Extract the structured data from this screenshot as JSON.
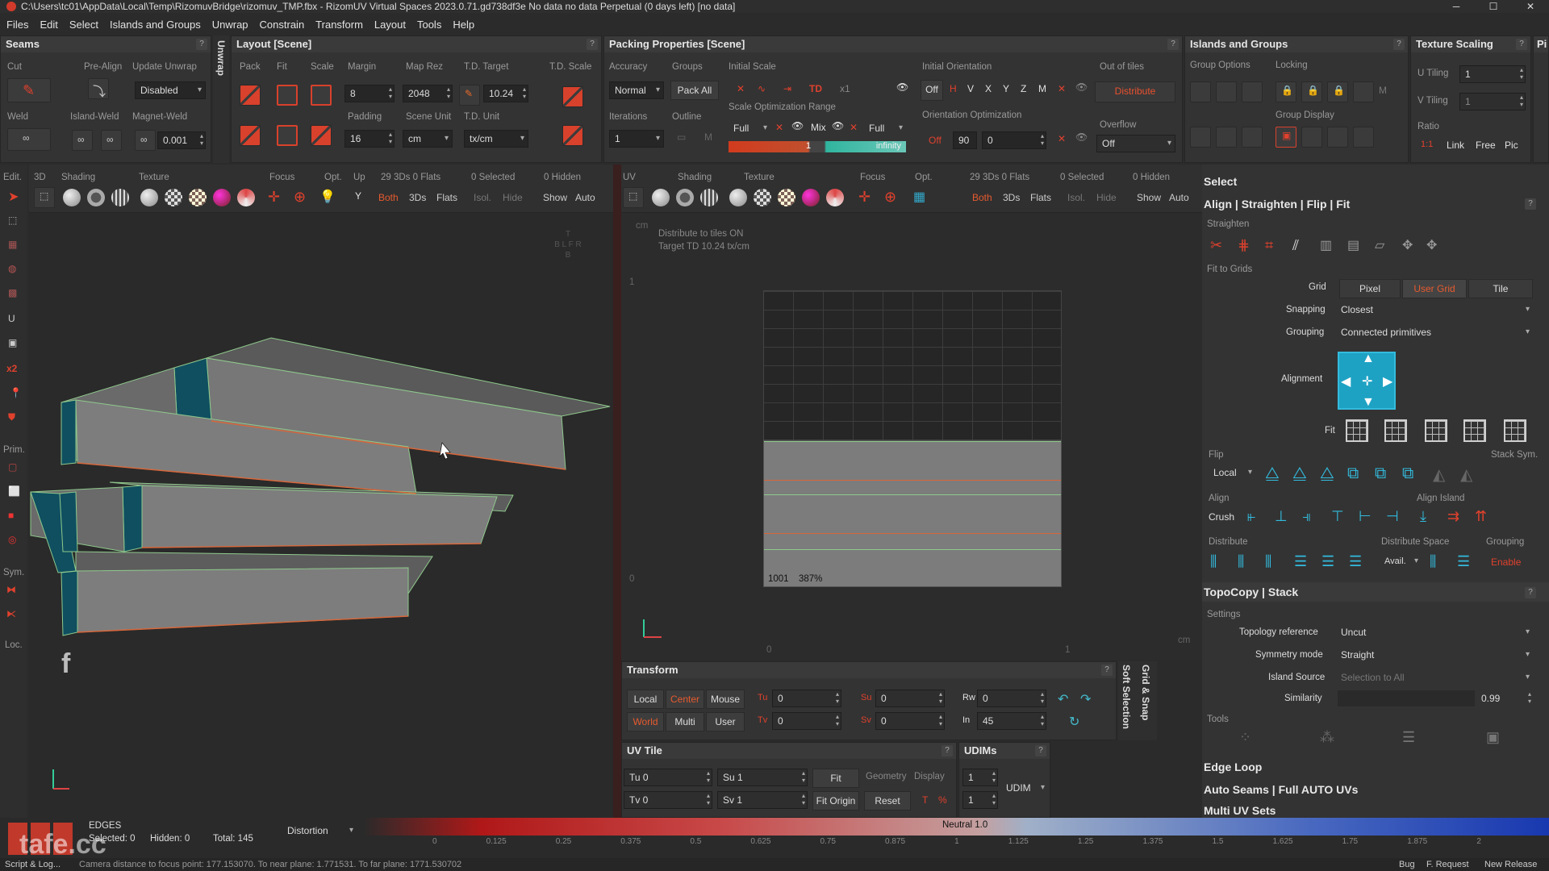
{
  "window": {
    "title": "C:\\Users\\tc01\\AppData\\Local\\Temp\\RizomuvBridge\\rizomuv_TMP.fbx - RizomUV  Virtual Spaces 2023.0.71.gd738df3e No data no data Perpetual  (0 days left) [no data]",
    "min": "─",
    "max": "☐",
    "close": "✕"
  },
  "menu": [
    "Files",
    "Edit",
    "Select",
    "Islands and Groups",
    "Unwrap",
    "Constrain",
    "Transform",
    "Layout",
    "Tools",
    "Help"
  ],
  "seams": {
    "title": "Seams",
    "help": "?",
    "cut": "Cut",
    "pre_align": "Pre-Align",
    "update_unwrap": "Update Unwrap",
    "update_value": "Disabled",
    "weld": "Weld",
    "island_weld": "Island-Weld",
    "magnet_weld": "Magnet-Weld",
    "magnet_value": "0.001",
    "unwrap_tab": "Unwrap"
  },
  "layout": {
    "title": "Layout [Scene]",
    "help": "?",
    "pack": "Pack",
    "fit": "Fit",
    "scale": "Scale",
    "margin": "Margin",
    "margin_value": "8",
    "map_rez": "Map Rez",
    "map_rez_value": "2048",
    "td_target": "T.D. Target",
    "td_target_value": "10.24",
    "td_scale": "T.D. Scale",
    "padding": "Padding",
    "padding_value": "16",
    "scene_unit": "Scene Unit",
    "scene_unit_value": "cm",
    "td_unit": "T.D. Unit",
    "td_unit_value": "tx/cm"
  },
  "packing": {
    "title": "Packing Properties [Scene]",
    "help": "?",
    "accuracy": "Accuracy",
    "accuracy_value": "Normal",
    "groups": "Groups",
    "pack_all": "Pack All",
    "initial_scale": "Initial Scale",
    "initial_scale_x1": "x1",
    "iterations": "Iterations",
    "iterations_value": "1",
    "outline": "Outline",
    "outline_m": "M",
    "scale_opt_range": "Scale Optimization Range",
    "full1": "Full",
    "mix": "Mix",
    "full2": "Full",
    "range_min": "1",
    "range_max": "infinity",
    "initial_orientation": "Initial Orientation",
    "orient_off": "Off",
    "orient_h": "H",
    "orient_v": "V",
    "orient_x": "X",
    "orient_y": "Y",
    "orient_z": "Z",
    "orient_m": "M",
    "orientation_optimization": "Orientation Optimization",
    "opt_off": "Off",
    "opt_step": "90",
    "opt_value": "0",
    "out_of_tiles": "Out of tiles",
    "distribute": "Distribute",
    "overflow": "Overflow",
    "overflow_value": "Off"
  },
  "islands": {
    "title": "Islands and Groups",
    "help": "?",
    "group_options": "Group Options",
    "locking": "Locking",
    "group_display": "Group Display",
    "m": "M"
  },
  "texture_scaling": {
    "title": "Texture Scaling",
    "help": "?",
    "u_tiling": "U Tiling",
    "u_value": "1",
    "v_tiling": "V Tiling",
    "v_value": "1",
    "ratio": "Ratio",
    "ratio_1_1": "1:1",
    "link": "Link",
    "free": "Free",
    "pic": "Pic",
    "cut_title": "Pi"
  },
  "vp3d": {
    "edit": "Edit.",
    "mode3d": "3D",
    "shading": "Shading",
    "texture": "Texture",
    "focus": "Focus",
    "opt": "Opt.",
    "up": "Up",
    "up_value": "Y",
    "counts": "29 3Ds 0 Flats",
    "selected": "0 Selected",
    "hidden": "0 Hidden",
    "both": "Both",
    "threeds": "3Ds",
    "flats": "Flats",
    "isol": "Isol.",
    "hide": "Hide",
    "show": "Show",
    "auto": "Auto",
    "cube_t": "T",
    "cube_row": "B L F R",
    "cube_b": "B",
    "prim": "Prim.",
    "sym": "Sym.",
    "loc": "Loc.",
    "x2": "x2"
  },
  "vpuv": {
    "uv": "UV",
    "shading": "Shading",
    "texture": "Texture",
    "focus": "Focus",
    "opt": "Opt.",
    "counts": "29 3Ds 0 Flats",
    "selected": "0 Selected",
    "hidden": "0 Hidden",
    "both": "Both",
    "threeds": "3Ds",
    "flats": "Flats",
    "isol": "Isol.",
    "hide": "Hide",
    "show": "Show",
    "auto": "Auto",
    "unit": "cm",
    "info1": "Distribute to tiles  ON",
    "info2": "Target TD  10.24 tx/cm",
    "tile_label": "1001",
    "zoom": "387%",
    "ruler_1": "1",
    "ruler_0": "0",
    "ruler_x0": "0",
    "ruler_x1": "1",
    "ruler_cm": "cm"
  },
  "transform": {
    "title": "Transform",
    "help": "?",
    "local": "Local",
    "center": "Center",
    "mouse": "Mouse",
    "world": "World",
    "multi": "Multi",
    "user": "User",
    "tu": "Tu",
    "tu_value": "0",
    "tv": "Tv",
    "tv_value": "0",
    "su": "Su",
    "su_value": "0",
    "sv": "Sv",
    "sv_value": "0",
    "rw": "Rw",
    "rw_value": "0",
    "in": "In",
    "in_value": "45",
    "soft_selection": "Soft Selection",
    "grid_snap": "Grid & Snap"
  },
  "uvtile": {
    "title": "UV Tile",
    "help": "?",
    "tu": "Tu 0",
    "tv": "Tv 0",
    "su": "Su 1",
    "sv": "Sv 1",
    "fit": "Fit",
    "fit_origin": "Fit Origin",
    "geometry": "Geometry",
    "display": "Display",
    "reset": "Reset",
    "t": "T",
    "pct": "%"
  },
  "udims": {
    "title": "UDIMs",
    "help": "?",
    "val1": "1",
    "val2": "1",
    "mode": "UDIM"
  },
  "right": {
    "select": "Select",
    "align_title": "Align | Straighten | Flip | Fit",
    "help": "?",
    "straighten": "Straighten",
    "fit_to_grids": "Fit to Grids",
    "grid": "Grid",
    "pixel": "Pixel",
    "user_grid": "User Grid",
    "tile": "Tile",
    "snapping": "Snapping",
    "snapping_value": "Closest",
    "grouping": "Grouping",
    "grouping_value": "Connected primitives",
    "alignment": "Alignment",
    "fit": "Fit",
    "flip": "Flip",
    "flip_local": "Local",
    "stack_sym": "Stack Sym.",
    "align": "Align",
    "crush": "Crush",
    "align_island": "Align Island",
    "distribute": "Distribute",
    "distribute_space": "Distribute Space",
    "avail": "Avail.",
    "grouping2": "Grouping",
    "enable": "Enable",
    "topocopy": "TopoCopy | Stack",
    "settings": "Settings",
    "topology_reference": "Topology reference",
    "topology_value": "Uncut",
    "symmetry_mode": "Symmetry mode",
    "symmetry_value": "Straight",
    "island_source": "Island Source",
    "island_source_value": "Selection to All",
    "similarity": "Similarity",
    "similarity_value": "0.99",
    "tools": "Tools",
    "edge_loop": "Edge Loop",
    "auto_seams": "Auto Seams | Full AUTO UVs",
    "multi_uv": "Multi UV Sets"
  },
  "status": {
    "edges": "EDGES",
    "selected": "Selected: 0",
    "hidden": "Hidden: 0",
    "total": "Total: 145",
    "distortion": "Distortion",
    "neutral": "Neutral 1.0",
    "ticks": [
      "0",
      "0.125",
      "0.25",
      "0.375",
      "0.5",
      "0.625",
      "0.75",
      "0.875",
      "1",
      "1.125",
      "1.25",
      "1.375",
      "1.5",
      "1.625",
      "1.75",
      "1.875",
      "2"
    ],
    "script": "Script & Log...",
    "camera": "Camera distance to focus point: 177.153070. To near plane: 1.771531. To far plane: 1771.530702",
    "bug": "Bug",
    "f_request": "F. Request",
    "new_release": "New Release",
    "watermark": "tafe.cc"
  }
}
